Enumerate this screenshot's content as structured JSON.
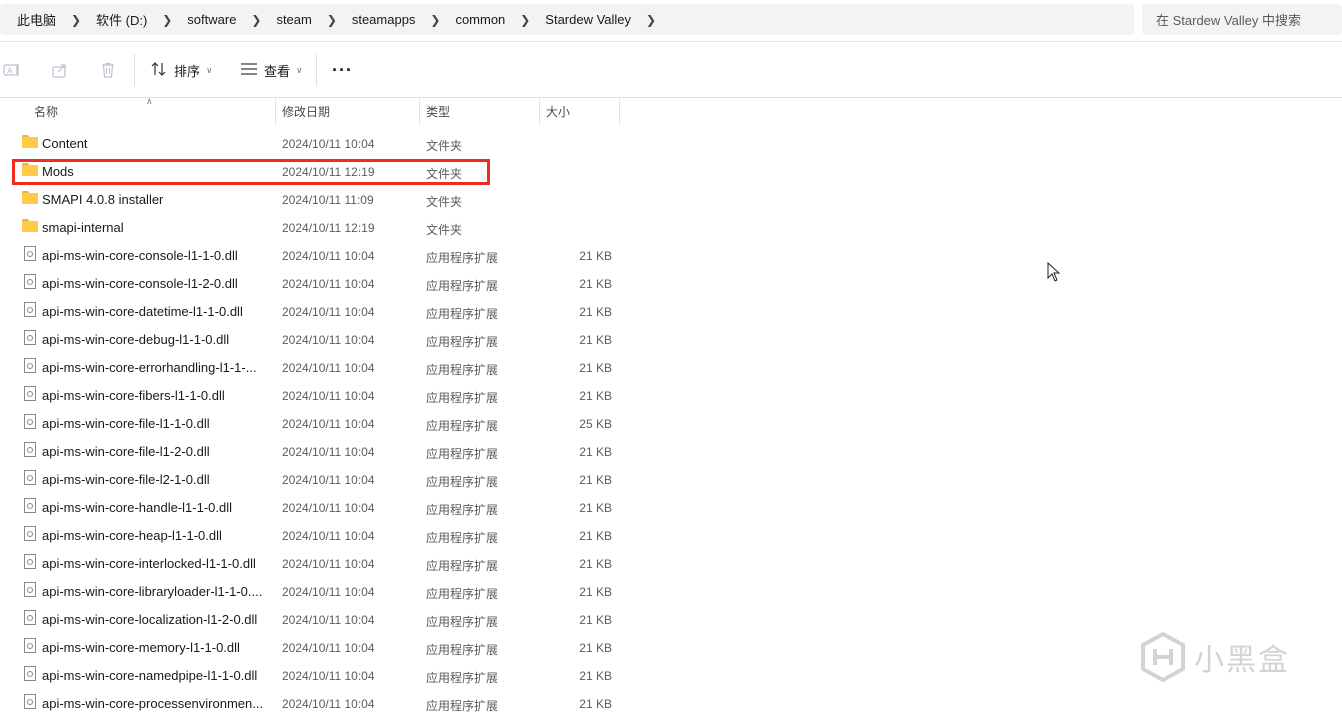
{
  "breadcrumbs": [
    "此电脑",
    "软件 (D:)",
    "software",
    "steam",
    "steamapps",
    "common",
    "Stardew Valley"
  ],
  "search": {
    "placeholder": "在 Stardew Valley 中搜索"
  },
  "toolbar": {
    "sort_label": "排序",
    "view_label": "查看",
    "more_label": "···",
    "icons": [
      "rename-icon",
      "share-icon",
      "delete-icon",
      "sort-icon",
      "view-icon",
      "more-icon"
    ]
  },
  "columns": {
    "name": "名称",
    "date": "修改日期",
    "type": "类型",
    "size": "大小"
  },
  "files": [
    {
      "name": "Content",
      "date": "2024/10/11 10:04",
      "type": "文件夹",
      "size": "",
      "kind": "folder"
    },
    {
      "name": "Mods",
      "date": "2024/10/11 12:19",
      "type": "文件夹",
      "size": "",
      "kind": "folder"
    },
    {
      "name": "SMAPI 4.0.8 installer",
      "date": "2024/10/11 11:09",
      "type": "文件夹",
      "size": "",
      "kind": "folder"
    },
    {
      "name": "smapi-internal",
      "date": "2024/10/11 12:19",
      "type": "文件夹",
      "size": "",
      "kind": "folder"
    },
    {
      "name": "api-ms-win-core-console-l1-1-0.dll",
      "date": "2024/10/11 10:04",
      "type": "应用程序扩展",
      "size": "21 KB",
      "kind": "dll"
    },
    {
      "name": "api-ms-win-core-console-l1-2-0.dll",
      "date": "2024/10/11 10:04",
      "type": "应用程序扩展",
      "size": "21 KB",
      "kind": "dll"
    },
    {
      "name": "api-ms-win-core-datetime-l1-1-0.dll",
      "date": "2024/10/11 10:04",
      "type": "应用程序扩展",
      "size": "21 KB",
      "kind": "dll"
    },
    {
      "name": "api-ms-win-core-debug-l1-1-0.dll",
      "date": "2024/10/11 10:04",
      "type": "应用程序扩展",
      "size": "21 KB",
      "kind": "dll"
    },
    {
      "name": "api-ms-win-core-errorhandling-l1-1-...",
      "date": "2024/10/11 10:04",
      "type": "应用程序扩展",
      "size": "21 KB",
      "kind": "dll"
    },
    {
      "name": "api-ms-win-core-fibers-l1-1-0.dll",
      "date": "2024/10/11 10:04",
      "type": "应用程序扩展",
      "size": "21 KB",
      "kind": "dll"
    },
    {
      "name": "api-ms-win-core-file-l1-1-0.dll",
      "date": "2024/10/11 10:04",
      "type": "应用程序扩展",
      "size": "25 KB",
      "kind": "dll"
    },
    {
      "name": "api-ms-win-core-file-l1-2-0.dll",
      "date": "2024/10/11 10:04",
      "type": "应用程序扩展",
      "size": "21 KB",
      "kind": "dll"
    },
    {
      "name": "api-ms-win-core-file-l2-1-0.dll",
      "date": "2024/10/11 10:04",
      "type": "应用程序扩展",
      "size": "21 KB",
      "kind": "dll"
    },
    {
      "name": "api-ms-win-core-handle-l1-1-0.dll",
      "date": "2024/10/11 10:04",
      "type": "应用程序扩展",
      "size": "21 KB",
      "kind": "dll"
    },
    {
      "name": "api-ms-win-core-heap-l1-1-0.dll",
      "date": "2024/10/11 10:04",
      "type": "应用程序扩展",
      "size": "21 KB",
      "kind": "dll"
    },
    {
      "name": "api-ms-win-core-interlocked-l1-1-0.dll",
      "date": "2024/10/11 10:04",
      "type": "应用程序扩展",
      "size": "21 KB",
      "kind": "dll"
    },
    {
      "name": "api-ms-win-core-libraryloader-l1-1-0....",
      "date": "2024/10/11 10:04",
      "type": "应用程序扩展",
      "size": "21 KB",
      "kind": "dll"
    },
    {
      "name": "api-ms-win-core-localization-l1-2-0.dll",
      "date": "2024/10/11 10:04",
      "type": "应用程序扩展",
      "size": "21 KB",
      "kind": "dll"
    },
    {
      "name": "api-ms-win-core-memory-l1-1-0.dll",
      "date": "2024/10/11 10:04",
      "type": "应用程序扩展",
      "size": "21 KB",
      "kind": "dll"
    },
    {
      "name": "api-ms-win-core-namedpipe-l1-1-0.dll",
      "date": "2024/10/11 10:04",
      "type": "应用程序扩展",
      "size": "21 KB",
      "kind": "dll"
    },
    {
      "name": "api-ms-win-core-processenvironmen...",
      "date": "2024/10/11 10:04",
      "type": "应用程序扩展",
      "size": "21 KB",
      "kind": "dll"
    }
  ],
  "highlight": {
    "row": "Mods",
    "color": "#ef2b22"
  },
  "watermark": {
    "text": "小黑盒"
  },
  "colors": {
    "folder": "#ffcb46",
    "address_bg": "#f3f3f3"
  }
}
